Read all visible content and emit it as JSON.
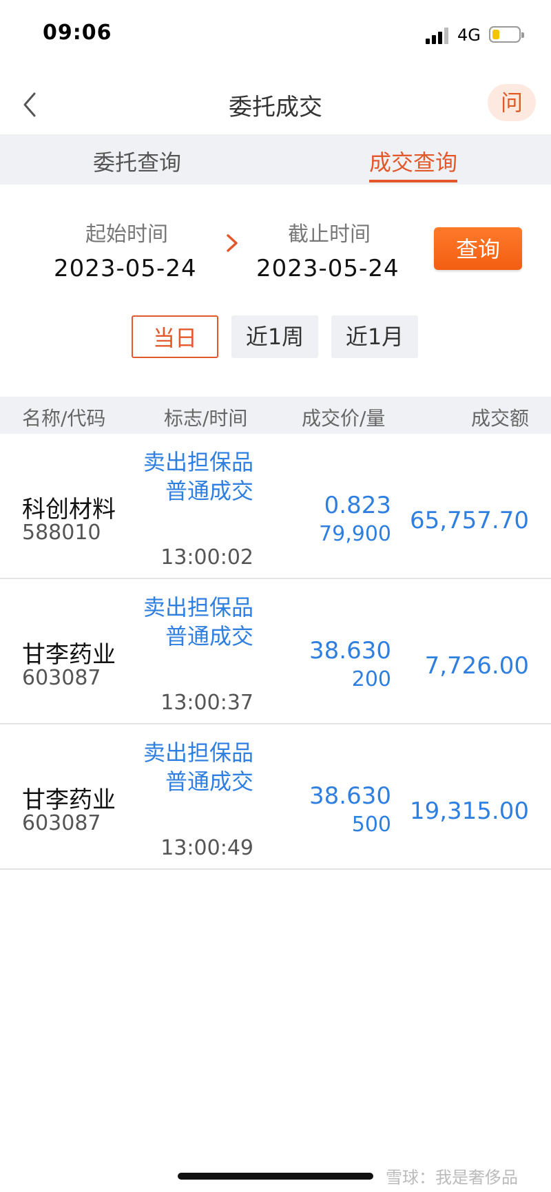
{
  "status": {
    "time": "09:06",
    "network": "4G"
  },
  "nav": {
    "title": "委托成交",
    "help_label": "问"
  },
  "tabs": [
    {
      "label": "委托查询",
      "active": false
    },
    {
      "label": "成交查询",
      "active": true
    }
  ],
  "date_range": {
    "start_label": "起始时间",
    "start_value": "2023-05-24",
    "end_label": "截止时间",
    "end_value": "2023-05-24",
    "query_label": "查询"
  },
  "quick_filters": [
    {
      "label": "当日",
      "active": true
    },
    {
      "label": "近1周",
      "active": false
    },
    {
      "label": "近1月",
      "active": false
    }
  ],
  "table": {
    "headers": [
      "名称/代码",
      "标志/时间",
      "成交价/量",
      "成交额"
    ],
    "rows": [
      {
        "name": "科创材料",
        "code": "588010",
        "flag": "卖出担保品普通成交",
        "time": "13:00:02",
        "price": "0.823",
        "qty": "79,900",
        "amount": "65,757.70"
      },
      {
        "name": "甘李药业",
        "code": "603087",
        "flag": "卖出担保品普通成交",
        "time": "13:00:37",
        "price": "38.630",
        "qty": "200",
        "amount": "7,726.00"
      },
      {
        "name": "甘李药业",
        "code": "603087",
        "flag": "卖出担保品普通成交",
        "time": "13:00:49",
        "price": "38.630",
        "qty": "500",
        "amount": "19,315.00"
      }
    ]
  },
  "watermark": "雪球：我是奢侈品",
  "colors": {
    "accent": "#e2582a",
    "value_blue": "#2f7fe0",
    "tab_bg": "#f0f1f5"
  },
  "battery_level": 0.25
}
